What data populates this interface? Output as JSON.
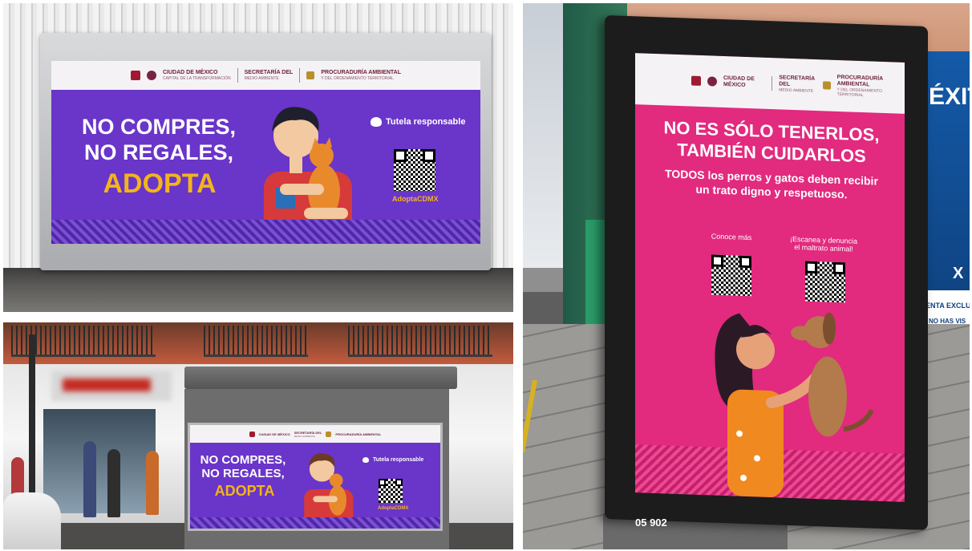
{
  "panel_top_left": {
    "ad": {
      "header": {
        "logo1_name": "CIUDAD DE MÉXICO",
        "logo1_sub": "CAPITAL DE LA TRANSFORMACIÓN",
        "logo2_name": "SECRETARÍA DEL",
        "logo2_sub": "MEDIO AMBIENTE",
        "logo3_name": "PROCURADURÍA AMBIENTAL",
        "logo3_sub": "Y DEL ORDENAMIENTO TERRITORIAL"
      },
      "slogan_line1": "NO COMPRES,",
      "slogan_line2": "NO REGALES,",
      "slogan_emphasis": "ADOPTA",
      "tutela_label": "Tutela responsable",
      "qr_caption": "AdoptaCDMX",
      "accent_color": "#6a35c9",
      "highlight_color": "#f2b51a"
    }
  },
  "panel_bottom_left": {
    "ad": {
      "slogan_line1": "NO COMPRES,",
      "slogan_line2": "NO REGALES,",
      "slogan_emphasis": "ADOPTA",
      "tutela_label": "Tutela responsable",
      "qr_caption": "AdoptaCDMX"
    }
  },
  "panel_right": {
    "ad": {
      "header": {
        "logo1_name": "CIUDAD DE MÉXICO",
        "logo2_name": "SECRETARÍA DEL",
        "logo2_sub": "MEDIO AMBIENTE",
        "logo3_name": "PROCURADURÍA AMBIENTAL",
        "logo3_sub": "Y DEL ORDENAMIENTO TERRITORIAL"
      },
      "slogan_line1": "NO ES SÓLO TENERLOS,",
      "slogan_line2": "TAMBIÉN CUIDARLOS",
      "subtext_line1": "TODOS los perros y gatos deben recibir",
      "subtext_line2": "un trato digno y respetuoso.",
      "qr1_label": "Conoce más",
      "qr2_label_line1": "¡Escanea y denuncia",
      "qr2_label_line2": "el maltrato animal!",
      "accent_color": "#e22a7e"
    },
    "kiosk_serial": "05 902",
    "background_ad": {
      "word": "ÉXITO",
      "sale_line": "VENTA EXCLU",
      "sub_line": "NO HAS VIS",
      "x_mark": "X"
    }
  }
}
